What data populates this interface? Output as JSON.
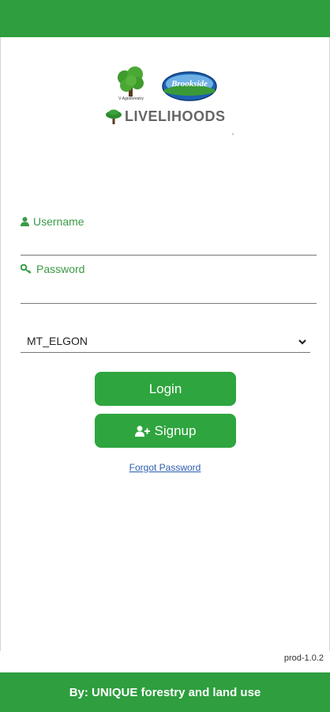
{
  "colors": {
    "accent": "#2e9e3e",
    "button": "#2ea53e",
    "label": "#3a9a46",
    "link": "#2a5db0"
  },
  "logos": {
    "agroforestry_caption": "V Agroforestry",
    "brookside_text": "Brookside",
    "brand_title": "LIVELIHOODS"
  },
  "form": {
    "username": {
      "label": "Username",
      "icon": "user-icon",
      "value": ""
    },
    "password": {
      "label": "Password",
      "icon": "key-icon",
      "value": ""
    },
    "region": {
      "selected": "MT_ELGON",
      "icon": "chevron-down-icon"
    }
  },
  "buttons": {
    "login": "Login",
    "signup": "Signup",
    "signup_icon": "add-user-icon"
  },
  "forgot_password": "Forgot Password",
  "version": "prod-1.0.2",
  "footer": "By: UNIQUE forestry and land use"
}
